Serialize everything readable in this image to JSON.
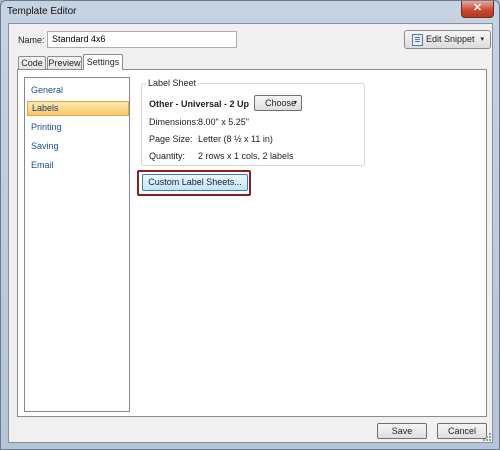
{
  "window": {
    "title": "Template Editor",
    "close_glyph": "✕"
  },
  "name_field": {
    "label": "Name:",
    "value": "Standard 4x6"
  },
  "edit_snippet": {
    "label": "Edit Snippet",
    "icon": "document-icon",
    "caret": "▾"
  },
  "tabs": [
    {
      "label": "Code"
    },
    {
      "label": "Preview"
    },
    {
      "label": "Settings",
      "selected": true
    }
  ],
  "sidebar": {
    "items": [
      {
        "label": "General"
      },
      {
        "label": "Labels",
        "selected": true
      },
      {
        "label": "Printing"
      },
      {
        "label": "Saving"
      },
      {
        "label": "Email"
      }
    ]
  },
  "label_sheet": {
    "legend": "Label Sheet",
    "sheet_name": "Other - Universal - 2 Up",
    "choose_label": "Choose",
    "choose_caret": "▾",
    "dimensions_label": "Dimensions:",
    "dimensions_value": "8.00\"  x  5.25\"",
    "page_size_label": "Page Size:",
    "page_size_value": "Letter (8 ½ x 11 in)",
    "quantity_label": "Quantity:",
    "quantity_value": "2 rows  x  1 cols,  2 labels"
  },
  "custom_label_sheets": {
    "label": "Custom Label Sheets...",
    "highlight_color": "#8c1e20"
  },
  "footer": {
    "save_label": "Save",
    "cancel_label": "Cancel"
  },
  "colors": {
    "selected_item_bg": "#f8c766",
    "link_text": "#1e4e9b",
    "close_button": "#c94b34"
  }
}
